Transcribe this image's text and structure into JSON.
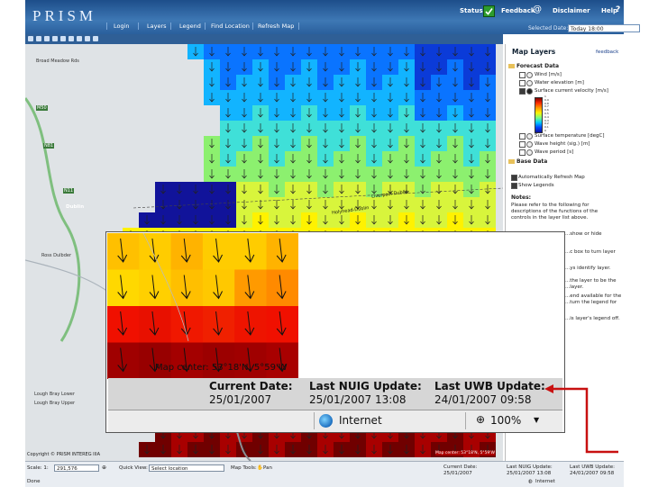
{
  "header": {
    "logo": "PRISM",
    "nav": [
      "Login",
      "Layers",
      "Legend",
      "Find Location",
      "Refresh Map"
    ],
    "status_label": "Status",
    "feedback_label": "Feedback",
    "disclaimer_label": "Disclaimer",
    "help_label": "Help",
    "selected_date_label": "Selected Date:",
    "selected_date_value": "Today 18:00"
  },
  "map": {
    "places": [
      "Broad Meadow Rds",
      "Dublin",
      "Liverpool-Dublin",
      "Holyhead-Dublin",
      "Ross Dulbder",
      "Lough Bray Lower",
      "Lough Bray Upper",
      "Copyright © PRISM  INTEREG IIIA",
      "Map center: 53°18'N, 5°59'W",
      "M50",
      "N11",
      "N81"
    ]
  },
  "layers_panel": {
    "title": "Map Layers",
    "feedback_link": "feedback",
    "forecast_heading": "Forecast Data",
    "forecast_items": [
      "Wind [m/s]",
      "Water elevation [m]",
      "Surface current velocity [m/s]",
      "Surface temperature [degC]",
      "Wave height (sig.) [m]",
      "Wave period [s]"
    ],
    "base_heading": "Base Data",
    "base_items": [
      "Automatically Refresh Map",
      "Show Legends"
    ],
    "notes_heading": "Notes:",
    "notes_lines": [
      "Please refer to the following for",
      "descriptions of the functions of the",
      "controls in the layer list above.",
      "...show or hide",
      "...c box to turn layer",
      "...ys identify layer.",
      "...the layer to be the",
      "...layer.",
      "...end available for the",
      "...turn the legend for",
      "...is layer's legend off."
    ],
    "colorbar_ticks": [
      "1",
      "0.9",
      "0.8",
      "0.7",
      "0.6",
      "0.5",
      "0.4",
      "0.3",
      "0.2",
      "0.1",
      "0"
    ]
  },
  "bottom_bar": {
    "scale_label": "Scale: 1:",
    "scale_value": "291,576",
    "quick_view_label": "Quick View:",
    "quick_view_value": "Select location",
    "map_tools_label": "Map Tools:",
    "map_tools_value": "Pan",
    "current_date_label": "Current Date:",
    "current_date_value": "25/01/2007",
    "nuig_label": "Last NUIG Update:",
    "nuig_value": "25/01/2007 13:08",
    "uwb_label": "Last UWB Update:",
    "uwb_value": "24/01/2007 09:58",
    "done_label": "Done",
    "internet_label": "Internet"
  },
  "zoom_panel": {
    "map_center": "Map center: 53°18'N, 5°59'W",
    "current_date_label": "Current Date:",
    "current_date_value": "25/01/2007",
    "nuig_label": "Last NUIG Update:",
    "nuig_value": "25/01/2007 13:08",
    "uwb_label": "Last UWB Update:",
    "uwb_value": "24/01/2007 09:58",
    "zone_label": "Internet",
    "zoom_level": "100%"
  },
  "colors": {
    "header_blue": "#2a5f9c",
    "pointer_red": "#c81010",
    "status_green": "#2e9d2e"
  }
}
